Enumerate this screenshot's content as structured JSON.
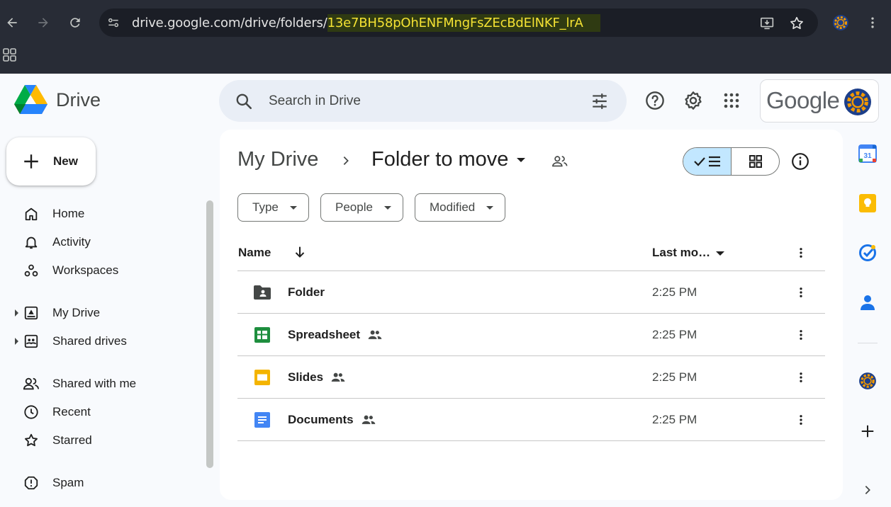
{
  "browser": {
    "url_base": "drive.google.com/drive/folders/",
    "url_highlight": "13e7BH58pOhENFMngFsZEcBdElNKF_lrA"
  },
  "header": {
    "app_name": "Drive",
    "search_placeholder": "Search in Drive",
    "account_brand": "Google"
  },
  "sidebar": {
    "new_label": "New",
    "items": [
      {
        "label": "Home",
        "icon": "home-icon"
      },
      {
        "label": "Activity",
        "icon": "bell-icon"
      },
      {
        "label": "Workspaces",
        "icon": "workspaces-icon"
      },
      {
        "label": "My Drive",
        "icon": "my-drive-icon"
      },
      {
        "label": "Shared drives",
        "icon": "shared-drives-icon"
      },
      {
        "label": "Shared with me",
        "icon": "people-icon"
      },
      {
        "label": "Recent",
        "icon": "clock-icon"
      },
      {
        "label": "Starred",
        "icon": "star-icon"
      },
      {
        "label": "Spam",
        "icon": "spam-icon"
      }
    ]
  },
  "main": {
    "breadcrumb_root": "My Drive",
    "breadcrumb_current": "Folder to move",
    "filters": [
      "Type",
      "People",
      "Modified"
    ],
    "columns": {
      "name": "Name",
      "modified": "Last mo…"
    },
    "rows": [
      {
        "name": "Folder",
        "type": "shared-folder",
        "shared": false,
        "modified": "2:25 PM"
      },
      {
        "name": "Spreadsheet",
        "type": "sheets",
        "shared": true,
        "modified": "2:25 PM"
      },
      {
        "name": "Slides",
        "type": "slides",
        "shared": true,
        "modified": "2:25 PM"
      },
      {
        "name": "Documents",
        "type": "docs",
        "shared": true,
        "modified": "2:25 PM"
      }
    ]
  },
  "side_panel": {
    "calendar_day": "31",
    "apps": [
      "calendar-icon",
      "keep-icon",
      "tasks-icon",
      "contacts-icon",
      "extension-icon",
      "add-icon",
      "expand-icon"
    ]
  },
  "colors": {
    "accent_light_blue": "#c2e7ff",
    "sheets_green": "#1e8e3e",
    "slides_yellow": "#f4b400",
    "docs_blue": "#4285f4",
    "highlight_url": "#f4e233"
  }
}
